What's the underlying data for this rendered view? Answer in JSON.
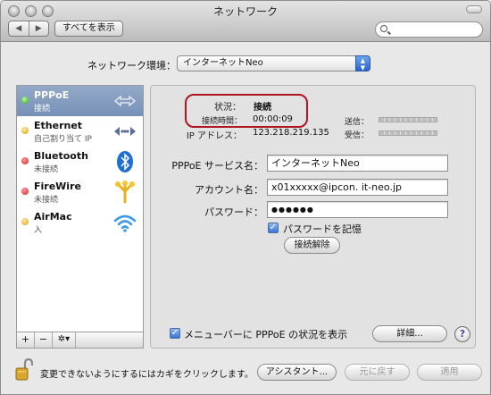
{
  "window": {
    "title": "ネットワーク"
  },
  "toolbar": {
    "back_label": "◀",
    "forward_label": "▶",
    "show_all_label": "すべてを表示",
    "search_placeholder": ""
  },
  "environment": {
    "label": "ネットワーク環境：",
    "value": "インターネットNeo"
  },
  "services": [
    {
      "name": "PPPoE",
      "status": "接続",
      "dot": "green",
      "icon": "pppoe-arrows-icon",
      "selected": true
    },
    {
      "name": "Ethernet",
      "status": "自己割り当て IP",
      "dot": "yellow",
      "icon": "ethernet-arrows-icon",
      "selected": false
    },
    {
      "name": "Bluetooth",
      "status": "未接続",
      "dot": "red",
      "icon": "bluetooth-icon",
      "selected": false
    },
    {
      "name": "FireWire",
      "status": "未接続",
      "dot": "red",
      "icon": "firewire-icon",
      "selected": false
    },
    {
      "name": "AirMac",
      "status": "入",
      "dot": "yellow",
      "icon": "wifi-icon",
      "selected": false
    }
  ],
  "sidebar_footer": {
    "add": "+",
    "remove": "−",
    "gear": "✲▾"
  },
  "status": {
    "status_label": "状況：",
    "status_value": "接続",
    "time_label": "接続時間：",
    "time_value": "00:00:09",
    "ip_label": "IP アドレス：",
    "ip_value": "123.218.219.135",
    "sent_label": "送信：",
    "received_label": "受信："
  },
  "form": {
    "service_name_label": "PPPoE サービス名：",
    "service_name_value": "インターネットNeo",
    "account_label": "アカウント名：",
    "account_value": "x01xxxxx@ipcon. it-neo.jp",
    "password_label": "パスワード：",
    "password_value": "●●●●●●",
    "remember_password_label": "パスワードを記憶",
    "disconnect_label": "接続解除"
  },
  "menubar_option": {
    "label": "メニューバーに PPPoE の状況を表示"
  },
  "details_label": "詳細...",
  "help_label": "?",
  "footer": {
    "lock_text": "変更できないようにするにはカギをクリックします。",
    "assistant_label": "アシスタント...",
    "revert_label": "元に戻す",
    "apply_label": "適用"
  },
  "colors": {
    "selection": "#7f97bd",
    "annotation_oval": "#b01522",
    "accent": "#3a74d4"
  }
}
